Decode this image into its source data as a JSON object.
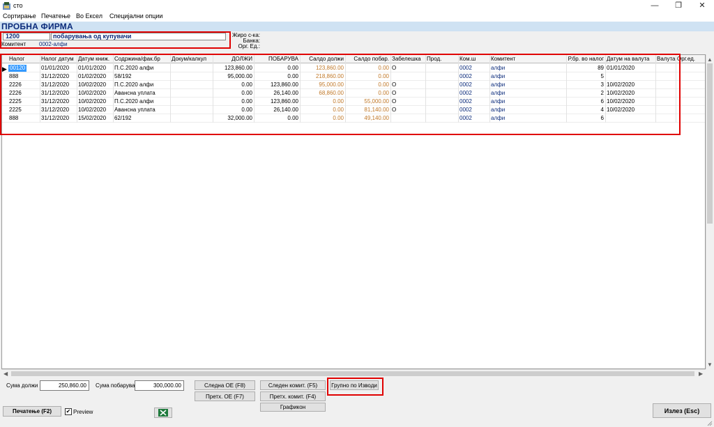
{
  "window": {
    "title": "сто",
    "minimize": "—",
    "restore": "❐",
    "close": "✕"
  },
  "menu": [
    "Сортирање",
    "Печатење",
    "Во Ексел",
    "Специјални опции"
  ],
  "company": "ПРОБНА ФИРМА",
  "account": {
    "code": "1200",
    "name": "побарувања од купувачи",
    "komitent_label": "Комитент",
    "komitent_value": "0002-алфи"
  },
  "info": {
    "ziro_label": "Жиро с-ка:",
    "banka_label": "Банка:",
    "org_label": "Орг. Ед.:"
  },
  "table": {
    "columns": [
      "Налог",
      "Налог датум",
      "Датум книж.",
      "Содржина/фак.бр",
      "Докум/калкул",
      "ДОЛЖИ",
      "ПОБАРУВА",
      "Салдо должи",
      "Салдо побар.",
      "Забелешка",
      "Прод.",
      "Ком.ш",
      "Комитент",
      "Р.бр. во налог",
      "Датум на валута",
      "Валута",
      "Орг.ед."
    ],
    "rows": [
      [
        "00120",
        "01/01/2020",
        "01/01/2020",
        "П.С.2020 алфи",
        "",
        "123,860.00",
        "0.00",
        "123,860.00",
        "0.00",
        "О",
        "",
        "0002",
        "алфи",
        "89",
        "01/01/2020",
        "",
        ""
      ],
      [
        "888",
        "31/12/2020",
        "01/02/2020",
        "58/192",
        "",
        "95,000.00",
        "0.00",
        "218,860.00",
        "0.00",
        "",
        "",
        "0002",
        "алфи",
        "5",
        "",
        "",
        ""
      ],
      [
        "2226",
        "31/12/2020",
        "10/02/2020",
        "П.С.2020 алфи",
        "",
        "0.00",
        "123,860.00",
        "95,000.00",
        "0.00",
        "О",
        "",
        "0002",
        "алфи",
        "3",
        "10/02/2020",
        "",
        ""
      ],
      [
        "2226",
        "31/12/2020",
        "10/02/2020",
        "Авансна уплата",
        "",
        "0.00",
        "26,140.00",
        "68,860.00",
        "0.00",
        "О",
        "",
        "0002",
        "алфи",
        "2",
        "10/02/2020",
        "",
        ""
      ],
      [
        "2225",
        "31/12/2020",
        "10/02/2020",
        "П.С.2020 алфи",
        "",
        "0.00",
        "123,860.00",
        "0.00",
        "55,000.00",
        "О",
        "",
        "0002",
        "алфи",
        "6",
        "10/02/2020",
        "",
        ""
      ],
      [
        "2225",
        "31/12/2020",
        "10/02/2020",
        "Авансна уплата",
        "",
        "0.00",
        "26,140.00",
        "0.00",
        "81,140.00",
        "О",
        "",
        "0002",
        "алфи",
        "4",
        "10/02/2020",
        "",
        ""
      ],
      [
        "888",
        "31/12/2020",
        "15/02/2020",
        "62/192",
        "",
        "32,000.00",
        "0.00",
        "0.00",
        "49,140.00",
        "",
        "",
        "0002",
        "алфи",
        "6",
        "",
        "",
        ""
      ]
    ]
  },
  "footer": {
    "suma_dolzi_label": "Сума должи",
    "suma_dolzi_value": "250,860.00",
    "suma_pobaruva_label": "Сума побарува",
    "suma_pobaruva_value": "300,000.00",
    "next_oe": "Следна ОЕ (F8)",
    "prev_oe": "Претх. ОЕ (F7)",
    "next_komit": "Следен комит. (F5)",
    "prev_komit": "Претх. комит. (F4)",
    "grafikon": "Графикон",
    "grupno": "Групно по Изводи",
    "print": "Печатење (F2)",
    "preview_label": "Preview",
    "exit": "Излез (Esc)"
  },
  "icons": {
    "row_pointer": "▶",
    "scroll_up": "▲",
    "scroll_down": "▼",
    "scroll_left": "◀",
    "scroll_right": "▶",
    "checkmark": "✔"
  },
  "colors": {
    "header_band": "#cfe2f3",
    "company_text": "#0a2a7a",
    "saldo_text": "#c07828",
    "highlight_frame": "#e00000",
    "selection": "#3399ff"
  }
}
